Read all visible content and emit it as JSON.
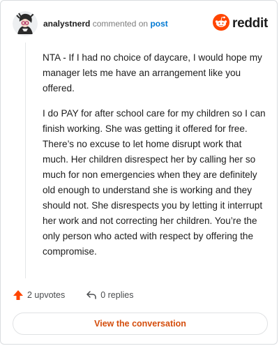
{
  "header": {
    "username": "analystnerd",
    "commented_on": "commented on",
    "post_link": "post",
    "logo_word": "reddit"
  },
  "comment": {
    "paragraphs": [
      "NTA - If I had no choice of daycare, I would hope my manager lets me have an arrangement like you offered.",
      "I do PAY for after school care for my children so I can finish working. She was getting it offered for free. There’s no excuse to let home disrupt work that much. Her children disrespect her by calling her so much for non emergencies when they are definitely old enough to understand she is working and they should not. She disrespects you by letting it interrupt her work and not correcting her children. You’re the only person who acted with respect by offering the compromise."
    ]
  },
  "actions": {
    "upvotes": "2 upvotes",
    "replies": "0 replies"
  },
  "cta": {
    "label": "View the conversation"
  },
  "colors": {
    "brand": "#ff4500",
    "link": "#0079d3",
    "cta_text": "#d44d0c"
  },
  "icons": [
    "avatar",
    "reddit-logo-icon",
    "upvote-arrow-icon",
    "reply-icon"
  ]
}
